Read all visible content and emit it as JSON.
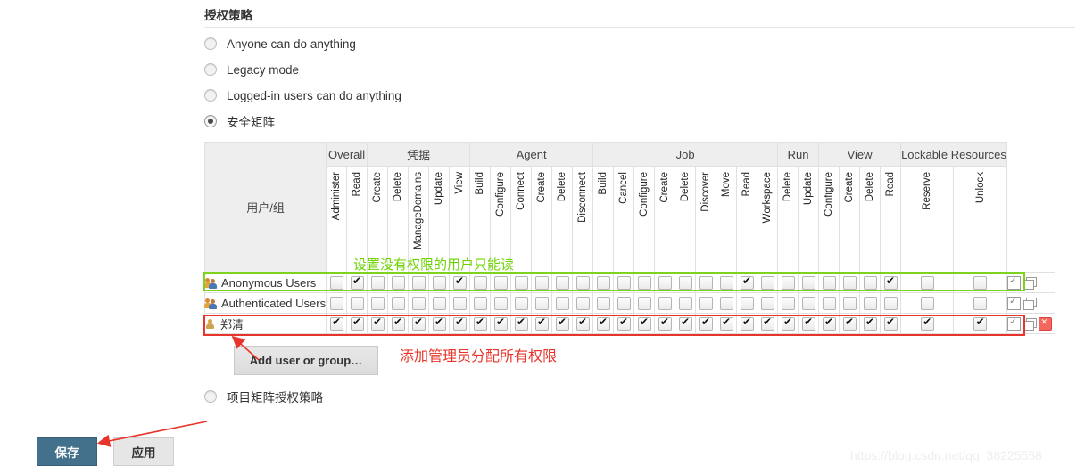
{
  "section": {
    "title": "授权策略"
  },
  "strategies": [
    {
      "label": "Anyone can do anything",
      "selected": false
    },
    {
      "label": "Legacy mode",
      "selected": false
    },
    {
      "label": "Logged-in users can do anything",
      "selected": false
    },
    {
      "label": "安全矩阵",
      "selected": true
    },
    {
      "label": "项目矩阵授权策略",
      "selected": false
    }
  ],
  "matrix": {
    "user_group_header": "用户/组",
    "groups": [
      {
        "label": "Overall",
        "span": 2
      },
      {
        "label": "凭据",
        "span": 5
      },
      {
        "label": "Agent",
        "span": 6
      },
      {
        "label": "Job",
        "span": 9
      },
      {
        "label": "Run",
        "span": 2
      },
      {
        "label": "View",
        "span": 4
      },
      {
        "label": "Lockable Resources",
        "span": 2
      }
    ],
    "columns": [
      "Administer",
      "Read",
      "Create",
      "Delete",
      "ManageDomains",
      "Update",
      "View",
      "Build",
      "Configure",
      "Connect",
      "Create",
      "Delete",
      "Disconnect",
      "Build",
      "Cancel",
      "Configure",
      "Create",
      "Delete",
      "Discover",
      "Move",
      "Read",
      "Workspace",
      "Delete",
      "Update",
      "Configure",
      "Create",
      "Delete",
      "Read",
      "Reserve",
      "Unlock"
    ],
    "wide_columns": [
      28,
      29
    ],
    "rows": [
      {
        "name": "Anonymous Users",
        "icon": "group-icon",
        "deletable": false,
        "checks": [
          false,
          true,
          false,
          false,
          false,
          false,
          true,
          false,
          false,
          false,
          false,
          false,
          false,
          false,
          false,
          false,
          false,
          false,
          false,
          false,
          true,
          false,
          false,
          false,
          false,
          false,
          false,
          true,
          false,
          false
        ]
      },
      {
        "name": "Authenticated Users",
        "icon": "group-icon",
        "deletable": false,
        "checks": [
          false,
          false,
          false,
          false,
          false,
          false,
          false,
          false,
          false,
          false,
          false,
          false,
          false,
          false,
          false,
          false,
          false,
          false,
          false,
          false,
          false,
          false,
          false,
          false,
          false,
          false,
          false,
          false,
          false,
          false
        ]
      },
      {
        "name": "郑清",
        "icon": "user-icon",
        "deletable": true,
        "checks": [
          true,
          true,
          true,
          true,
          true,
          true,
          true,
          true,
          true,
          true,
          true,
          true,
          true,
          true,
          true,
          true,
          true,
          true,
          true,
          true,
          true,
          true,
          true,
          true,
          true,
          true,
          true,
          true,
          true,
          true
        ]
      }
    ],
    "row_actions": {
      "select_all": "select-all",
      "copy": "copy",
      "delete": "delete"
    }
  },
  "buttons": {
    "add_user_or_group": "Add user or group…",
    "save": "保存",
    "apply": "应用"
  },
  "annotations": {
    "green_note": "设置没有权限的用户只能读",
    "red_note": "添加管理员分配所有权限",
    "green_color": "#6dd400",
    "red_color": "#e8342a"
  },
  "watermark": {
    "text": "https://blog.csdn.net/qq_38225558"
  }
}
